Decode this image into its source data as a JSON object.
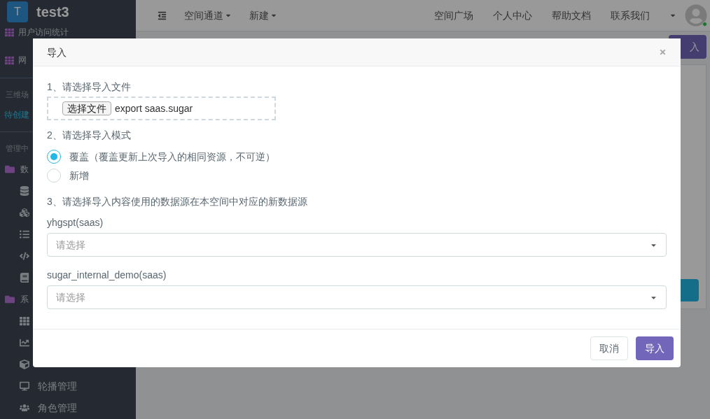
{
  "brand": {
    "logo": "T",
    "name": "test3"
  },
  "sidebar": {
    "items": [
      {
        "kind": "nav",
        "label": "用户访问统计"
      },
      {
        "kind": "nav",
        "label": "网"
      },
      {
        "kind": "divider"
      },
      {
        "kind": "section",
        "label": "三维场"
      },
      {
        "kind": "link",
        "label": "待创建"
      },
      {
        "kind": "divider"
      },
      {
        "kind": "section",
        "label": "管理中"
      },
      {
        "kind": "group",
        "label": "数"
      },
      {
        "kind": "sub"
      },
      {
        "kind": "sub"
      },
      {
        "kind": "sub"
      },
      {
        "kind": "sub"
      },
      {
        "kind": "sub"
      },
      {
        "kind": "group",
        "label": "系"
      },
      {
        "kind": "sub"
      },
      {
        "kind": "sub"
      },
      {
        "kind": "sub"
      },
      {
        "kind": "sub",
        "label": "轮播管理"
      },
      {
        "kind": "sub",
        "label": "角色管理"
      }
    ]
  },
  "topbar": {
    "left_menu": [
      {
        "label": "空间通道"
      },
      {
        "label": "新建"
      }
    ],
    "right_menu": [
      "空间广场",
      "个人中心",
      "帮助文档",
      "联系我们"
    ],
    "online": true
  },
  "page": {
    "import_button": "入"
  },
  "modal": {
    "title": "导入",
    "step1": "1、请选择导入文件",
    "file_button": "选择文件",
    "file_name": "export saas.sugar",
    "step2": "2、请选择导入模式",
    "modes": [
      {
        "label": "覆盖（覆盖更新上次导入的相同资源，不可逆）",
        "selected": true
      },
      {
        "label": "新增",
        "selected": false
      }
    ],
    "step3": "3、请选择导入内容使用的数据源在本空间中对应的新数据源",
    "sources": [
      {
        "label": "yhgspt(saas)",
        "placeholder": "请选择"
      },
      {
        "label": "sugar_internal_demo(saas)",
        "placeholder": "请选择"
      }
    ],
    "buttons": {
      "cancel": "取消",
      "confirm": "导入"
    }
  }
}
